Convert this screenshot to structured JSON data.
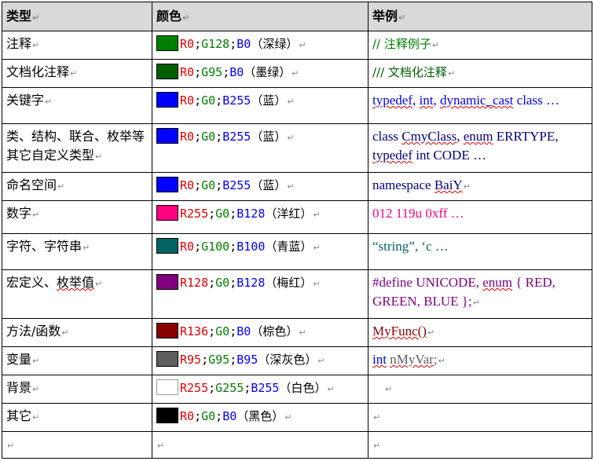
{
  "headers": {
    "type": "类型",
    "color": "颜色",
    "example": "举例"
  },
  "para_mark": "↵",
  "rows": [
    {
      "type": "注释",
      "swatch": "#008000",
      "r": "R0",
      "g": "G128",
      "b": "B0",
      "name": "（深绿）",
      "example": "// 注释例子"
    },
    {
      "type": "文档化注释",
      "swatch": "#005f00",
      "r": "R0",
      "g": "G95",
      "b": "B0",
      "name": "（墨绿）",
      "example": "///  文档化注释"
    },
    {
      "type": "关键字",
      "swatch": "#0000ff",
      "r": "R0",
      "g": "G0",
      "b": "B255",
      "name": "（蓝）",
      "example_parts": [
        "typedef",
        ", ",
        "int",
        ", ",
        "dynamic_cast",
        " class  …"
      ]
    },
    {
      "type": "类、结构、联合、枚举等其它自定义类型",
      "swatch": "#0000ff",
      "r": "R0",
      "g": "G0",
      "b": "B255",
      "name": "（蓝）",
      "example_parts": [
        "class ",
        "CmyClass",
        ", ",
        "enum",
        " ERRTYPE, ",
        "typedef",
        " int CODE  …"
      ]
    },
    {
      "type": "命名空间",
      "swatch": "#0000ff",
      "r": "R0",
      "g": "G0",
      "b": "B255",
      "name": "（蓝）",
      "example_parts": [
        "namespace ",
        "BaiY"
      ]
    },
    {
      "type": "数字",
      "swatch": "#ff0080",
      "r": "R255",
      "g": "G0",
      "b": "B128",
      "name": "（洋红）",
      "example": "012 119u 0xff  …"
    },
    {
      "type": "字符、字符串",
      "swatch": "#006464",
      "r": "R0",
      "g": "G100",
      "b": "B100",
      "name": "（青蓝）",
      "example": "“string”,  ‘c  …"
    },
    {
      "type_parts": [
        "宏定义、",
        "枚举值"
      ],
      "swatch": "#800080",
      "r": "R128",
      "g": "G0",
      "b": "B128",
      "name": "（梅红）",
      "example_parts": [
        "#define UNICODE, ",
        "enum",
        " { RED, GREEN, BLUE };"
      ]
    },
    {
      "type": "方法/函数",
      "swatch": "#880000",
      "r": "R136",
      "g": "G0",
      "b": "B0",
      "name": "（棕色）",
      "example": "MyFunc()"
    },
    {
      "type": "变量",
      "swatch": "#5f5f5f",
      "r": "R95",
      "g": "G95",
      "b": "B95",
      "name": "（深灰色）",
      "example_parts": [
        "int",
        " ",
        "nMyVar",
        ";"
      ]
    },
    {
      "type": "背景",
      "swatch": "#ffffff",
      "r": "R255",
      "g": "G255",
      "b": "B255",
      "name": "（白色）",
      "example": ""
    },
    {
      "type": "其它",
      "swatch": "#000000",
      "r": "R0",
      "g": "G0",
      "b": "B0",
      "name": "（黑色）",
      "example": ""
    },
    {
      "type": "",
      "example": ""
    }
  ]
}
